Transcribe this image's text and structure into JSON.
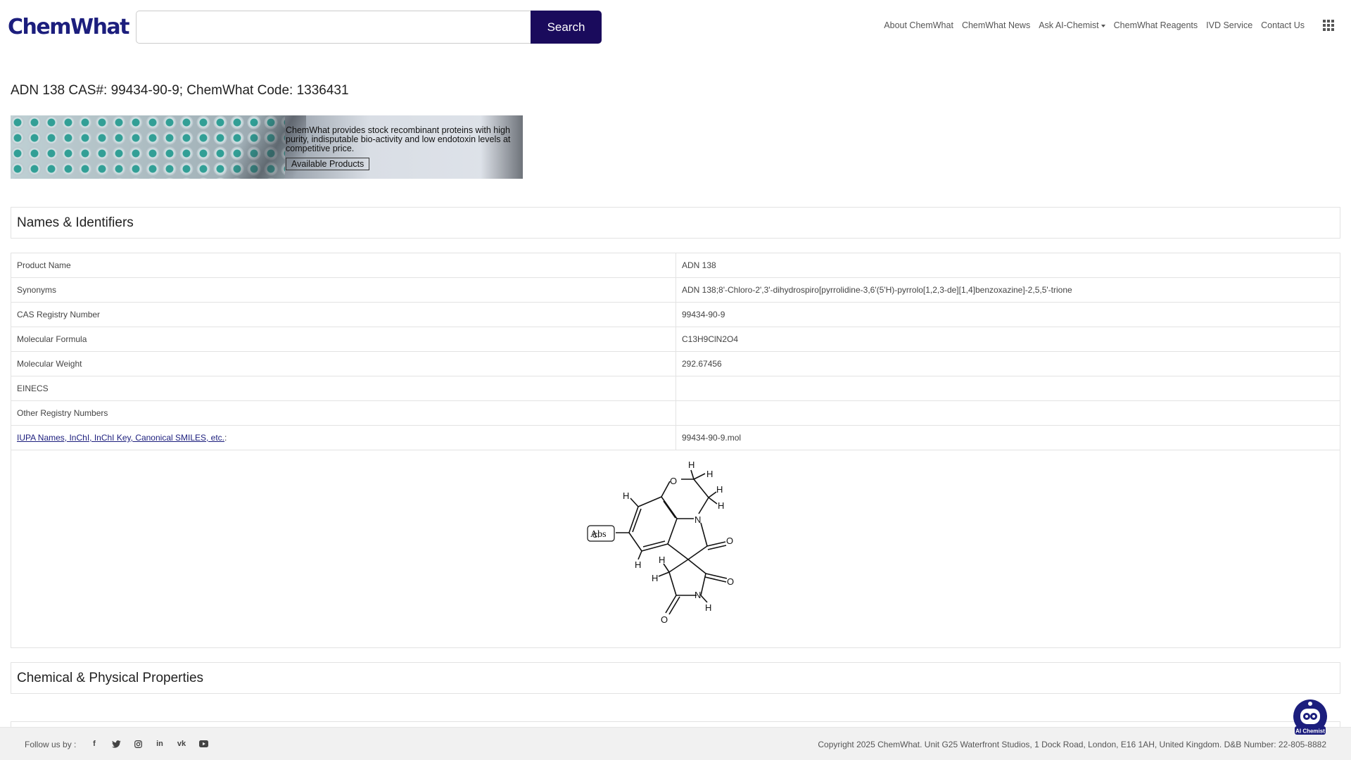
{
  "header": {
    "logo": "ChemWhat",
    "search_placeholder": "",
    "search_button": "Search",
    "nav": [
      "About ChemWhat",
      "ChemWhat News",
      "Ask AI-Chemist",
      "ChemWhat Reagents",
      "IVD Service",
      "Contact Us"
    ]
  },
  "page_title": "ADN 138 CAS#: 99434-90-9; ChemWhat Code: 1336431",
  "banner": {
    "text": "ChemWhat provides stock recombinant proteins with high purity, indisputable bio-activity and low endotoxin levels at competitive price.",
    "button": "Available Products"
  },
  "sections": {
    "names": "Names & Identifiers",
    "properties": "Chemical & Physical Properties"
  },
  "table": [
    {
      "key": "Product Name",
      "value": "ADN 138"
    },
    {
      "key": "Synonyms",
      "value": "ADN 138;8'-Chloro-2',3'-dihydrospiro[pyrrolidine-3,6'(5'H)-pyrrolo[1,2,3-de][1,4]benzoxazine]-2,5,5'-trione"
    },
    {
      "key": "CAS Registry Number",
      "value": "99434-90-9"
    },
    {
      "key": "Molecular Formula",
      "value": "C13H9ClN2O4"
    },
    {
      "key": "Molecular Weight",
      "value": "292.67456"
    },
    {
      "key": "EINECS",
      "value": ""
    },
    {
      "key": "Other Registry Numbers",
      "value": ""
    },
    {
      "key": "IUPA Names, InChI, InChI Key, Canonical SMILES, etc.",
      "key_suffix": ":",
      "value": "99434-90-9.mol"
    }
  ],
  "structure": {
    "atoms": [
      "H",
      "O",
      "H",
      "H",
      "H",
      "H",
      "N",
      "Abs",
      "Cl",
      "O",
      "H",
      "H",
      "H",
      "O",
      "N",
      "H",
      "O"
    ]
  },
  "footer": {
    "follow": "Follow us by :",
    "social": [
      "facebook-icon",
      "twitter-icon",
      "instagram-icon",
      "linkedin-icon",
      "vk-icon",
      "youtube-icon"
    ],
    "copyright": "Copyright 2025 ChemWhat. Unit G25 Waterfront Studios, 1 Dock Road, London, E16 1AH, United Kingdom. D&B Number: 22-805-8882"
  },
  "ai_chemist": "AI Chemist",
  "colors": {
    "brand": "#1c1e7d",
    "search_button": "#1a0b5c",
    "footer_bg": "#f1f1f1"
  }
}
